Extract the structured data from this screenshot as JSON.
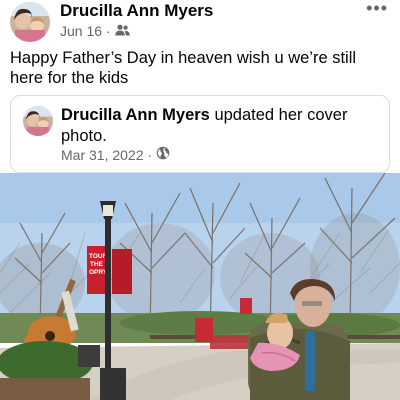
{
  "post": {
    "author": "Drucilla Ann Myers",
    "date": "Jun 16",
    "separator": "·",
    "audience_icon": "friends-icon",
    "more_icon": "more-options-icon",
    "more_label": "•••",
    "text": "Happy Father’s Day in heaven wish u we’re still here for the kids"
  },
  "shared": {
    "author": "Drucilla Ann Myers",
    "action": " updated her cover photo.",
    "date": "Mar 31, 2022",
    "separator": "·",
    "audience_icon": "public-globe-icon"
  },
  "photo": {
    "banner_text": [
      "TOUR",
      "THE",
      "OPRY"
    ],
    "colors": {
      "sky": "#b9d3ef",
      "banner": "#c8202c",
      "path": "#d6cfc4"
    }
  },
  "colors": {
    "text": "#050505",
    "secondary": "#65676b",
    "border": "#dadde1"
  }
}
